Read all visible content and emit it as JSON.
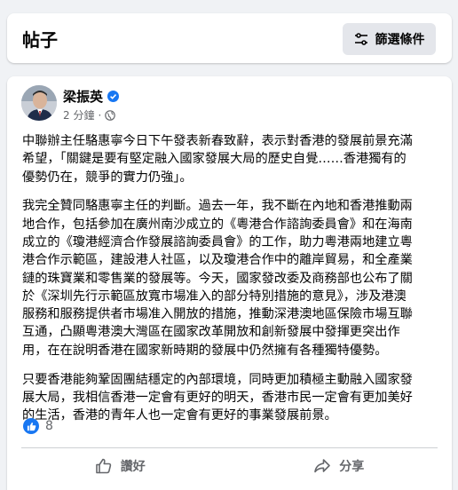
{
  "header": {
    "title": "帖子",
    "filter_label": "篩選條件"
  },
  "post": {
    "author": "梁振英",
    "time": "2 分鐘",
    "time_separator": "·",
    "paragraphs": [
      "中聯辦主任駱惠寧今日下午發表新春致辭，表示對香港的發展前景充滿\n希望，「關鍵是要有堅定融入國家發展大局的歷史自覺……香港獨有的\n優勢仍在，競爭的實力仍強」。",
      "我完全贊同駱惠寧主任的判斷。過去一年，我不斷在內地和香港推動兩\n地合作，包括參加在廣州南沙成立的《粵港合作諮詢委員會》和在海南\n成立的《瓊港經濟合作發展諮詢委員會》的工作，助力粵港兩地建立粵\n港合作示範區，建設港人社區，以及瓊港合作中的離岸貿易，和全產業\n鏈的珠寶業和零售業的發展等。今天，國家發改委及商務部也公布了關\n於《深圳先行示範區放寬市場准入的部分特別措施的意見》，涉及港澳\n服務和服務提供者市場准入開放的措施，推動深港澳地區保險市場互聯\n互通，凸顯粵港澳大灣區在國家改革開放和創新發展中發揮更突出作\n用，在在說明香港在國家新時期的發展中仍然擁有各種獨特優勢。",
      "只要香港能夠鞏固團結穩定的內部環境，同時更加積極主動融入國家發\n展大局，我相信香港一定會有更好的明天，香港市民一定會有更加美好\n的生活，香港的青年人也一定會有更好的事業發展前景。"
    ],
    "reaction_count": "8",
    "like_label": "讚好",
    "share_label": "分享"
  },
  "colors": {
    "accent": "#1877f2",
    "secondary_text": "#65676b",
    "background": "#f0f2f5"
  },
  "icons": [
    "filter-icon",
    "verified-icon",
    "globe-icon",
    "like-icon",
    "share-icon"
  ]
}
